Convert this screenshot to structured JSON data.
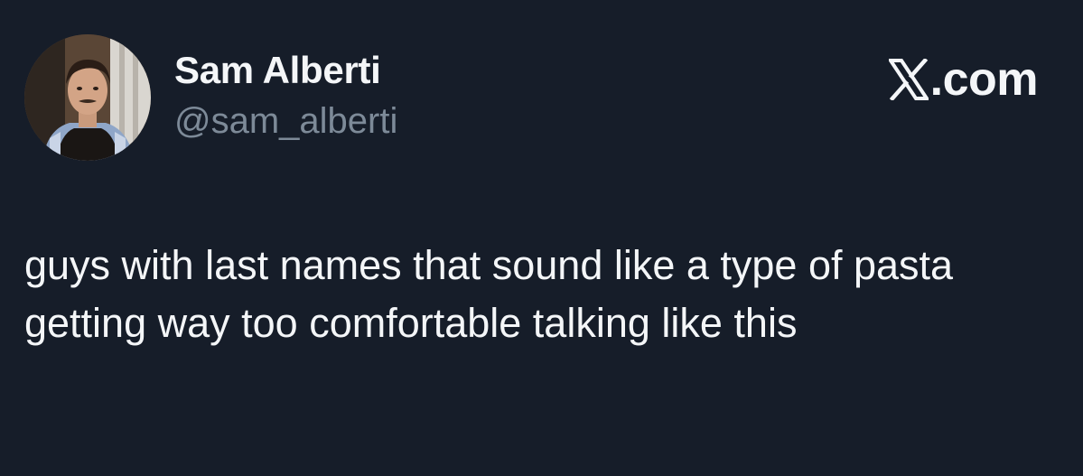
{
  "author": {
    "display_name": "Sam Alberti",
    "handle": "@sam_alberti",
    "avatar_icon": "profile-photo"
  },
  "brand": {
    "icon": "x-logo-icon",
    "suffix": ".com"
  },
  "tweet": {
    "text": "guys with last names that sound like a type of pasta getting way too comfortable talking like this"
  },
  "colors": {
    "background": "#161d29",
    "text_primary": "#f4f6f8",
    "text_secondary": "#7d8a98"
  }
}
